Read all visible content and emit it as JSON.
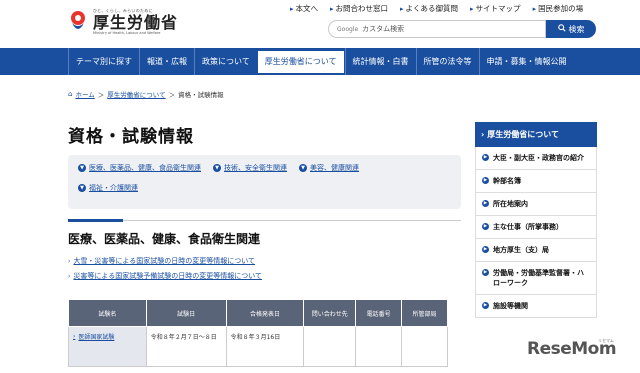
{
  "header": {
    "logo_tagline": "ひと、くらし、みらいのために",
    "logo_name": "厚生労働省",
    "logo_en": "Ministry of Health, Labour and Welfare",
    "utility_links": [
      "本文へ",
      "お問合わせ窓口",
      "よくある御質問",
      "サイトマップ",
      "国民参加の場"
    ],
    "search_brand": "Google",
    "search_placeholder": "カスタム検索",
    "search_button": "検索"
  },
  "nav": {
    "items": [
      "テーマ別に探す",
      "報道・広報",
      "政策について",
      "厚生労働省について",
      "統計情報・白書",
      "所管の法令等",
      "申請・募集・情報公開"
    ],
    "active_index": 3
  },
  "breadcrumb": {
    "items": [
      "ホーム",
      "厚生労働省について",
      "資格・試験情報"
    ]
  },
  "page": {
    "title": "資格・試験情報",
    "index_links_row1": [
      "医療、医薬品、健康、食品衛生関連",
      "技術、安全衛生関連",
      "美容、健康関連"
    ],
    "index_links_row2": [
      "福祉・介護関連"
    ],
    "section_title": "医療、医薬品、健康、食品衛生関連",
    "notices": [
      "大雪・災害等による国家試験の日時の変更等情報について",
      "災害等による国家試験予備試験の日時の変更等情報について"
    ]
  },
  "table": {
    "headers": [
      "試験名",
      "試験日",
      "合格発表日",
      "問い合わせ先",
      "電話番号",
      "所管部局"
    ],
    "rows": [
      {
        "name": "医師国家試験",
        "exam_date": "令和８年２月７日～８日",
        "result_date": "令和８年３月16日",
        "contact": "",
        "phone": "",
        "dept": ""
      }
    ]
  },
  "sidebar": {
    "heading": "厚生労働省について",
    "items": [
      "大臣・副大臣・政務官の紹介",
      "幹部名簿",
      "所在地案内",
      "主な仕事（所掌事務）",
      "地方厚生（支）局",
      "労働局・労働基準監督署・ハローワーク",
      "施設等機関"
    ]
  },
  "watermark": {
    "text": "ReseMom",
    "sub": "リセマム"
  },
  "colors": {
    "brand_blue": "#1a4fa0",
    "table_header": "#5a6478"
  }
}
